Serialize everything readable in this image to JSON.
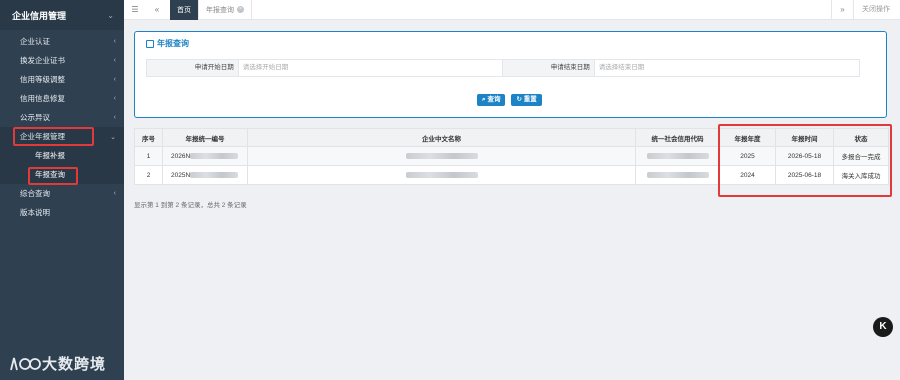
{
  "sidebar": {
    "title": "企业信用管理",
    "items": [
      {
        "label": "企业认证"
      },
      {
        "label": "换发企业证书"
      },
      {
        "label": "信用等级调整"
      },
      {
        "label": "信用信息修复"
      },
      {
        "label": "公示异议"
      },
      {
        "label": "企业年报管理"
      },
      {
        "label": "年报补报"
      },
      {
        "label": "年报查询"
      },
      {
        "label": "综合查询"
      },
      {
        "label": "版本说明"
      }
    ],
    "logo_text": "大数跨境",
    "logo_mark": "K"
  },
  "topbar": {
    "tab_home": "首页",
    "tab_current": "年报查询",
    "close_ops": "关闭操作"
  },
  "search": {
    "title": "年报查询",
    "start_label": "申请开始日期",
    "start_placeholder": "请选择开始日期",
    "end_label": "申请结束日期",
    "end_placeholder": "请选择结束日期",
    "query_btn": "查询",
    "reset_btn": "重置"
  },
  "table": {
    "headers": [
      "序号",
      "年报统一编号",
      "企业中文名称",
      "统一社会信用代码",
      "年报年度",
      "年报时间",
      "状态"
    ],
    "rows": [
      {
        "no": "1",
        "code_prefix": "2026N",
        "year": "2025",
        "date": "2026-05-18",
        "status": "多报合一完成"
      },
      {
        "no": "2",
        "code_prefix": "2025N",
        "year": "2024",
        "date": "2025-06-18",
        "status": "海关入库成功"
      }
    ],
    "footer": "显示第 1 到第 2 条记录，总共 2 条记录"
  },
  "fab_label": "K",
  "colors": {
    "sidebar": "#2f4050",
    "accent": "#1c84c6",
    "highlight": "#e03a3a"
  }
}
